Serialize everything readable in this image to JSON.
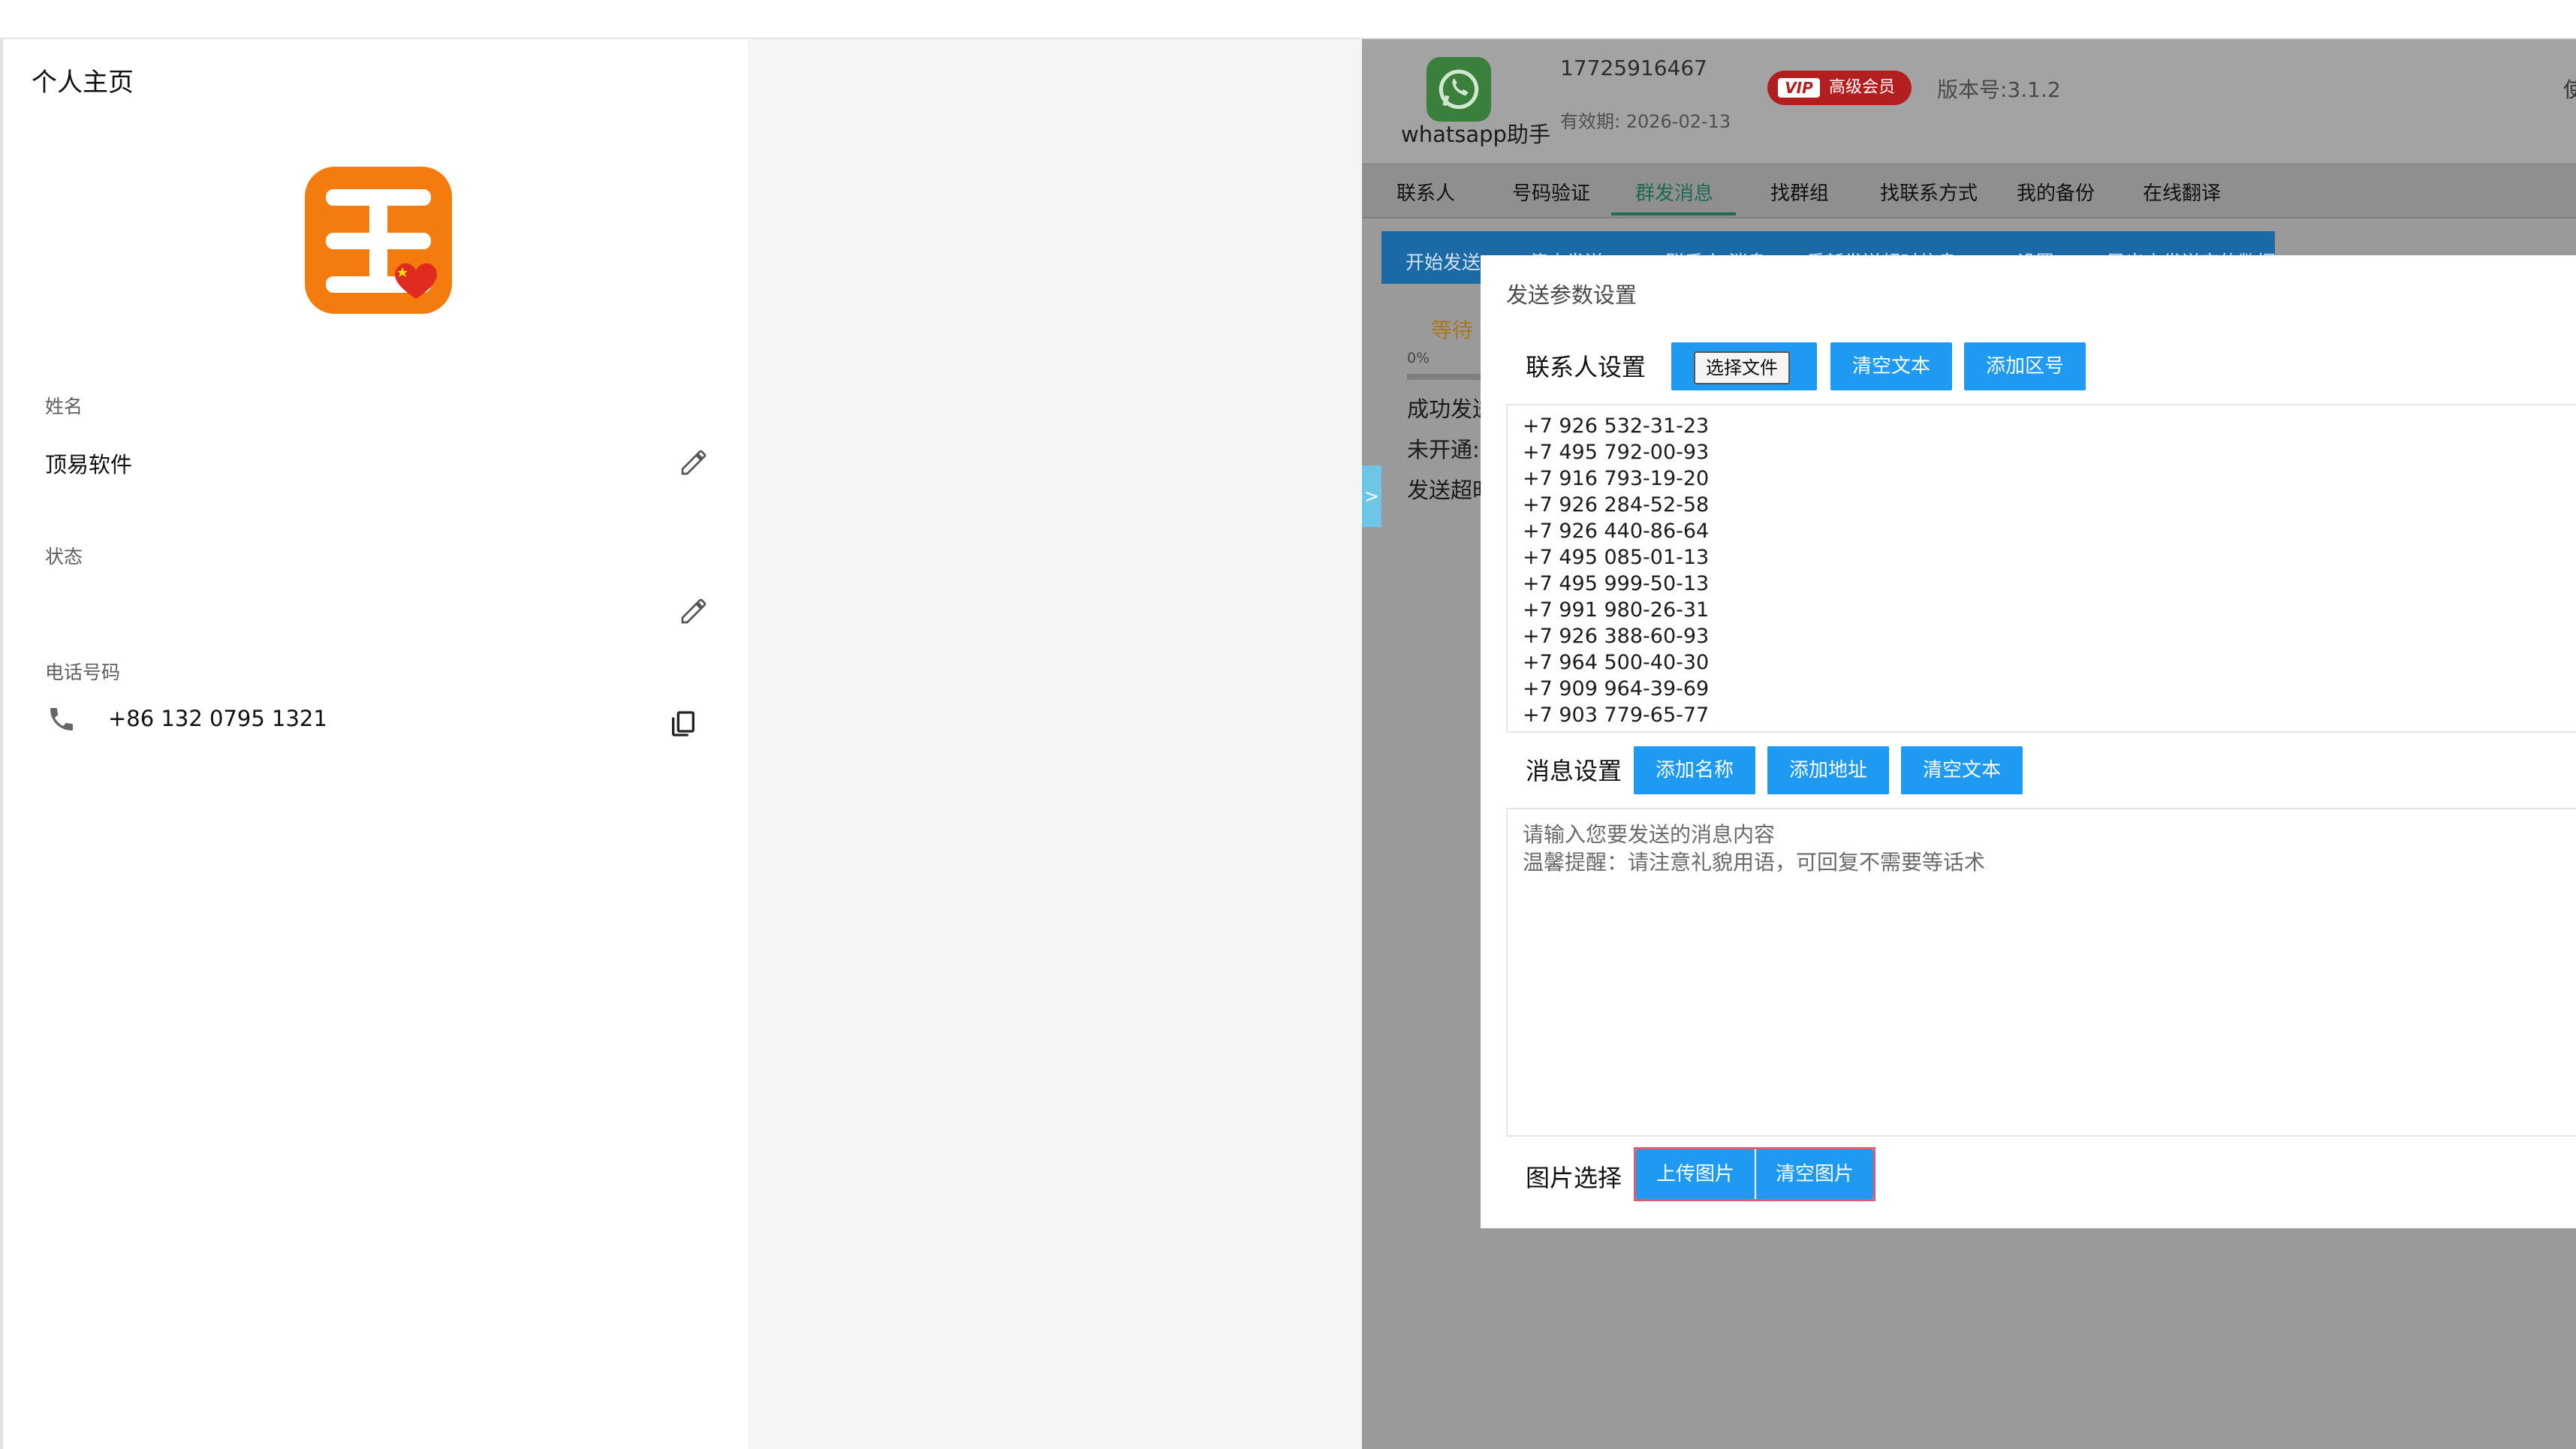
{
  "profile": {
    "title": "个人主页",
    "name_label": "姓名",
    "name_value": "顶易软件",
    "status_label": "状态",
    "status_value": "",
    "phone_label": "电话号码",
    "phone_value": "+86 132 0795 1321"
  },
  "app": {
    "brand_label": "whatsapp助手",
    "phone": "17725916467",
    "expiry": "有效期: 2026-02-13",
    "vip_tag": "VIP",
    "vip_text": "高级会员",
    "version": "版本号:3.1.2",
    "trail_char": "使",
    "nav": [
      "联系人",
      "号码验证",
      "群发消息",
      "找群组",
      "找联系方式",
      "我的备份",
      "在线翻译"
    ],
    "action_tabs": [
      "开始发送",
      "停止发送",
      "+联系人/消息",
      "重新发送超时信息",
      "设置",
      "导出未发送完的数据"
    ],
    "bg_wait": "等待",
    "bg_percent": "0%",
    "bg_rows": [
      "成功发送",
      "未开通:",
      "发送超时"
    ],
    "toggle": ">"
  },
  "modal": {
    "title": "发送参数设置",
    "contacts_label": "联系人设置",
    "btn_choose_file": "选择文件",
    "btn_clear_text": "清空文本",
    "btn_add_area": "添加区号",
    "numbers": [
      "+7 926 532-31-23",
      "+7 495 792-00-93",
      "+7 916 793-19-20",
      "+7 926 284-52-58",
      "+7 926 440-86-64",
      "+7 495 085-01-13",
      "+7 495 999-50-13",
      "+7 991 980-26-31",
      "+7 926 388-60-93",
      "+7 964 500-40-30",
      "+7 909 964-39-69",
      "+7 903 779-65-77"
    ],
    "message_label": "消息设置",
    "btn_add_name": "添加名称",
    "btn_add_address": "添加地址",
    "btn_clear_msg": "清空文本",
    "placeholder_line1": "请输入您要发送的消息内容",
    "placeholder_line2": "温馨提醒：请注意礼貌用语，可回复不需要等话术",
    "image_label": "图片选择",
    "btn_upload_image": "上传图片",
    "btn_clear_image": "清空图片"
  },
  "colors": {
    "accent_blue": "#1e9af2",
    "avatar_orange": "#f47c0e",
    "vip_red": "#b31e1e",
    "active_tab_green": "#1d6b55"
  }
}
